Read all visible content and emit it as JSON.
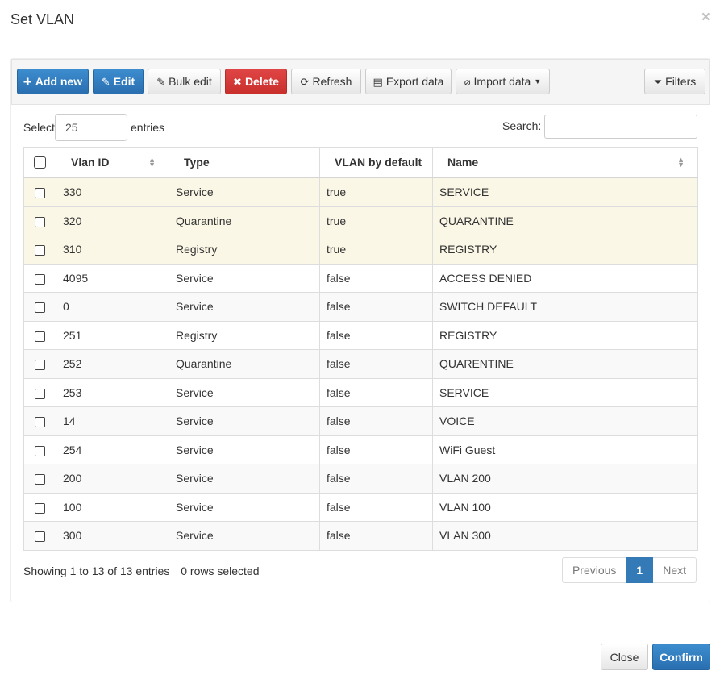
{
  "modal": {
    "title": "Set VLAN",
    "close_glyph": "×"
  },
  "toolbar": {
    "add_new": "Add new",
    "edit": "Edit",
    "bulk_edit": "Bulk edit",
    "delete": "Delete",
    "refresh": "Refresh",
    "export_data": "Export data",
    "import_data": "Import data",
    "filters": "Filters"
  },
  "length": {
    "label_before": "Select",
    "value": "25",
    "label_after": "entries"
  },
  "search": {
    "label": "Search:",
    "value": ""
  },
  "table": {
    "headers": {
      "vlan_id": "Vlan ID",
      "type": "Type",
      "by_default": "VLAN by default",
      "name": "Name"
    },
    "rows": [
      {
        "vlan_id": "330",
        "type": "Service",
        "by_default": "true",
        "name": "SERVICE"
      },
      {
        "vlan_id": "320",
        "type": "Quarantine",
        "by_default": "true",
        "name": "QUARANTINE"
      },
      {
        "vlan_id": "310",
        "type": "Registry",
        "by_default": "true",
        "name": "REGISTRY"
      },
      {
        "vlan_id": "4095",
        "type": "Service",
        "by_default": "false",
        "name": "ACCESS DENIED"
      },
      {
        "vlan_id": "0",
        "type": "Service",
        "by_default": "false",
        "name": "SWITCH DEFAULT"
      },
      {
        "vlan_id": "251",
        "type": "Registry",
        "by_default": "false",
        "name": "REGISTRY"
      },
      {
        "vlan_id": "252",
        "type": "Quarantine",
        "by_default": "false",
        "name": "QUARENTINE"
      },
      {
        "vlan_id": "253",
        "type": "Service",
        "by_default": "false",
        "name": "SERVICE"
      },
      {
        "vlan_id": "14",
        "type": "Service",
        "by_default": "false",
        "name": "VOICE"
      },
      {
        "vlan_id": "254",
        "type": "Service",
        "by_default": "false",
        "name": "WiFi Guest"
      },
      {
        "vlan_id": "200",
        "type": "Service",
        "by_default": "false",
        "name": "VLAN 200"
      },
      {
        "vlan_id": "100",
        "type": "Service",
        "by_default": "false",
        "name": "VLAN 100"
      },
      {
        "vlan_id": "300",
        "type": "Service",
        "by_default": "false",
        "name": "VLAN 300"
      }
    ]
  },
  "info": {
    "showing": "Showing 1 to 13 of 13 entries",
    "selected": "0 rows selected"
  },
  "pagination": {
    "previous": "Previous",
    "current": "1",
    "next": "Next"
  },
  "footer": {
    "close": "Close",
    "confirm": "Confirm"
  },
  "colors": {
    "primary": "#337ab7",
    "danger": "#d9534f",
    "highlight_row": "#fbf7e6"
  }
}
